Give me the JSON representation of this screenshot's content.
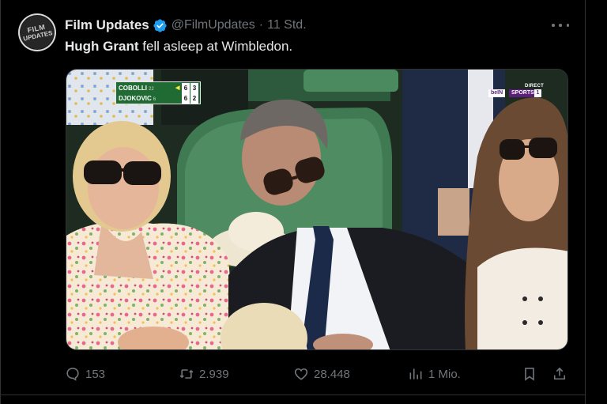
{
  "post": {
    "author_name": "Film Updates",
    "avatar_text_top": "FILM",
    "avatar_text_bottom": "UPDATES",
    "handle": "@FilmUpdates",
    "separator": "·",
    "time": "11 Std.",
    "text_bold": "Hugh Grant",
    "text_rest": " fell asleep at Wimbledon.",
    "verified_color": "#1d9bf0"
  },
  "media": {
    "scoreboard": {
      "player1": "COBOLLI",
      "player1_seed": "22",
      "player1_set1": "6",
      "player1_set2": "3",
      "player2": "DJOKOVIC",
      "player2_seed": "6",
      "player2_set1": "6",
      "player2_set2": "2"
    },
    "broadcaster": {
      "status": "DIRECT",
      "logo_left": "beIN",
      "logo_right": "SPORTS",
      "channel": "1"
    }
  },
  "actions": {
    "replies": "153",
    "reposts": "2.939",
    "likes": "28.448",
    "views": "1 Mio."
  }
}
